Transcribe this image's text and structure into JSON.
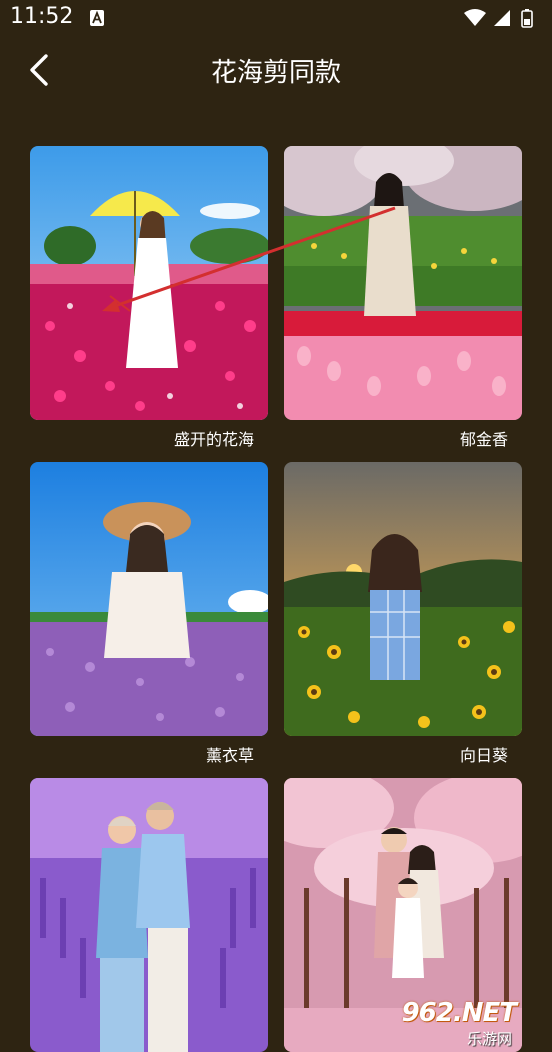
{
  "status_bar": {
    "time": "11:52"
  },
  "header": {
    "title": "花海剪同款",
    "back_icon": "chevron-left-icon"
  },
  "templates": [
    {
      "label": "盛开的花海"
    },
    {
      "label": "郁金香"
    },
    {
      "label": "薰衣草"
    },
    {
      "label": "向日葵"
    },
    {
      "label": ""
    },
    {
      "label": ""
    }
  ],
  "watermark": {
    "top": "962.NET",
    "bottom": "乐游网"
  }
}
